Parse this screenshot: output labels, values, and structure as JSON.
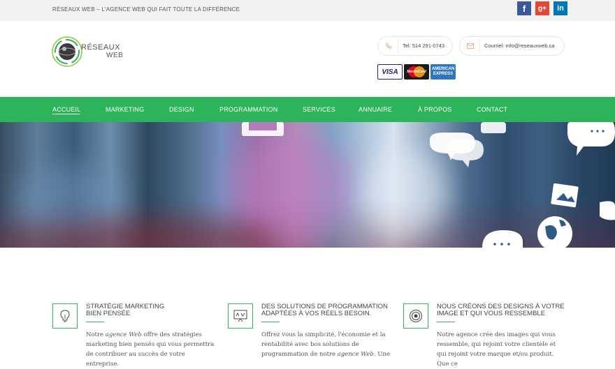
{
  "topbar": {
    "tagline": "RÉSEAUX WEB – L'AGENCE WEB QUI FAIT TOUTE LA DIFFÉRENCE",
    "social": [
      {
        "name": "facebook-icon",
        "glyph": "f"
      },
      {
        "name": "google-plus-icon",
        "glyph": "g+"
      },
      {
        "name": "linkedin-icon",
        "glyph": "in"
      }
    ]
  },
  "header": {
    "logo_line1": "RÉSEAUX",
    "logo_line2": "WEB",
    "phone": "Tel: 514 291-0743",
    "email": "Courriel: info@reseauxweb.ca",
    "cards": [
      "VISA",
      "MasterCard",
      "AMERICAN EXPRESS"
    ]
  },
  "nav": {
    "items": [
      {
        "label": "ACCUEIL",
        "active": true
      },
      {
        "label": "MARKETING"
      },
      {
        "label": "DESIGN"
      },
      {
        "label": "PROGRAMMATION"
      },
      {
        "label": "SERVICES"
      },
      {
        "label": "ANNUAIRE"
      },
      {
        "label": "À PROPOS"
      },
      {
        "label": "CONTACT"
      }
    ]
  },
  "features": [
    {
      "title_line1": "STRATÉGIE MARKETING",
      "title_line2": "BIEN PENSÉE",
      "body_pre": "Notre ",
      "body_em": "agence Web",
      "body_post": " offre des stratégies marketing bien pensés qui vous permettra de contribuer au succès de votre entreprise.",
      "icon": "lightbulb-icon"
    },
    {
      "title_line1": "DES SOLUTIONS DE PROGRAMMATION",
      "title_line2": "ADAPTÉES À VOS RÉELS BESOIN.",
      "body_pre": "Offrez vous la simplicité, l'économie et la rentabilité avec bos solutions de programmation de notre ",
      "body_em": "agence Web",
      "body_post": ". Une",
      "icon": "code-board-icon"
    },
    {
      "title_line1": "NOUS CRÉONS DES DESIGNS À VOTRE",
      "title_line2": "IMAGE ET QUI VOUS RESSEMBLE",
      "body_pre": "Notre agence crée des images qui vous ressemble, qui rejoint votre clientèle et qui rejoint votre marque et/ou produit. Que ce",
      "body_em": "",
      "body_post": "",
      "icon": "target-icon"
    }
  ],
  "colors": {
    "accent": "#2db35a",
    "topbar_bg": "#f2f2f2"
  }
}
